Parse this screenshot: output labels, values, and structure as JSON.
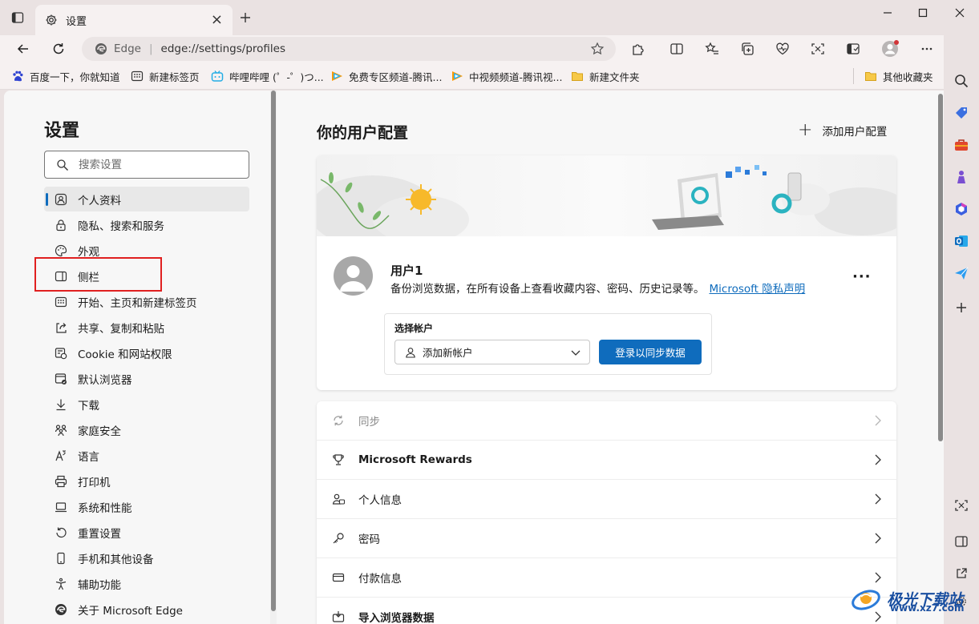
{
  "window": {
    "tab_title": "设置",
    "tab_icon": "gear-icon"
  },
  "address": {
    "site_label": "Edge",
    "url": "edge://settings/profiles"
  },
  "favorites": [
    {
      "label": "百度一下，你就知道",
      "icon": "baidu-paw-icon"
    },
    {
      "label": "新建标签页",
      "icon": "new-tab-icon"
    },
    {
      "label": "哔哩哔哩 (゜-゜)つ...",
      "icon": "bilibili-icon"
    },
    {
      "label": "免费专区频道-腾讯...",
      "icon": "tencent-video-icon"
    },
    {
      "label": "中视频频道-腾讯视...",
      "icon": "tencent-video-icon"
    },
    {
      "label": "新建文件夹",
      "icon": "folder-icon"
    }
  ],
  "other_favorites": "其他收藏夹",
  "settings": {
    "title": "设置",
    "search_placeholder": "搜索设置",
    "nav": [
      {
        "label": "个人资料",
        "icon": "profile-icon",
        "active": true
      },
      {
        "label": "隐私、搜索和服务",
        "icon": "lock-icon"
      },
      {
        "label": "外观",
        "icon": "palette-icon"
      },
      {
        "label": "侧栏",
        "icon": "sidebar-icon"
      },
      {
        "label": "开始、主页和新建标签页",
        "icon": "home-grid-icon"
      },
      {
        "label": "共享、复制和粘贴",
        "icon": "share-icon"
      },
      {
        "label": "Cookie 和网站权限",
        "icon": "cookie-icon"
      },
      {
        "label": "默认浏览器",
        "icon": "browser-icon"
      },
      {
        "label": "下载",
        "icon": "download-icon"
      },
      {
        "label": "家庭安全",
        "icon": "family-icon"
      },
      {
        "label": "语言",
        "icon": "language-icon"
      },
      {
        "label": "打印机",
        "icon": "printer-icon"
      },
      {
        "label": "系统和性能",
        "icon": "laptop-icon"
      },
      {
        "label": "重置设置",
        "icon": "reset-icon"
      },
      {
        "label": "手机和其他设备",
        "icon": "phone-icon"
      },
      {
        "label": "辅助功能",
        "icon": "accessibility-icon"
      },
      {
        "label": "关于 Microsoft Edge",
        "icon": "edge-icon"
      }
    ]
  },
  "profiles": {
    "title": "你的用户配置",
    "add_label": "添加用户配置",
    "user_name": "用户1",
    "user_desc": "备份浏览数据，在所有设备上查看收藏内容、密码、历史记录等。",
    "privacy_link": "Microsoft 隐私声明",
    "account_label": "选择帐户",
    "account_select": "添加新帐户",
    "signin_button": "登录以同步数据",
    "rows": [
      {
        "label": "同步",
        "icon": "sync-icon",
        "dim": true
      },
      {
        "label": "Microsoft Rewards",
        "icon": "trophy-icon",
        "bold": true
      },
      {
        "label": "个人信息",
        "icon": "person-card-icon"
      },
      {
        "label": "密码",
        "icon": "key-icon"
      },
      {
        "label": "付款信息",
        "icon": "card-icon"
      },
      {
        "label": "导入浏览器数据",
        "icon": "import-icon"
      }
    ]
  },
  "watermark": {
    "title": "极光下载站",
    "url": "www.xz7.com"
  },
  "colors": {
    "accent": "#0f6cbd",
    "highlight_box": "#e02020"
  }
}
